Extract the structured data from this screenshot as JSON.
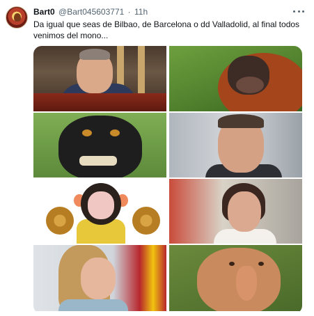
{
  "tweet": {
    "display_name": "Bart0",
    "handle": "@Bart045603771",
    "separator": "·",
    "time": "11h",
    "text": "Da igual que seas de Bilbao, de Barcelona o dd Valladolid, al final todos venimos del mono..."
  },
  "icons": {
    "avatar": "profile-avatar",
    "more": "more-dots-icon"
  },
  "colors": {
    "text_primary": "#0f1419",
    "text_secondary": "#536471"
  }
}
